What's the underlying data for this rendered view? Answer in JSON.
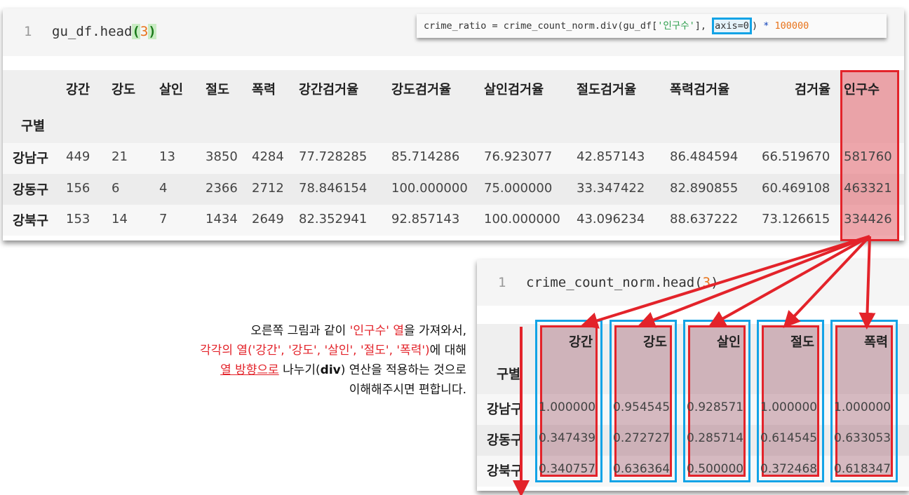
{
  "top_cell": {
    "line_number": "1",
    "code_prefix": "gu_df.head",
    "code_paren_open": "(",
    "code_arg": "3",
    "code_paren_close": ")"
  },
  "tooltip": {
    "part1": "crime_ratio = crime_count_norm.div(gu_df[",
    "string": "'인구수'",
    "part2": "], ",
    "highlight": "axis=0",
    "part3": ") ",
    "mul": "*",
    "number": " 100000"
  },
  "top_table": {
    "index_name": "구별",
    "columns": [
      "강간",
      "강도",
      "살인",
      "절도",
      "폭력",
      "강간검거율",
      "강도검거율",
      "살인검거율",
      "절도검거율",
      "폭력검거율",
      "검거율",
      "인구수"
    ],
    "rows": [
      {
        "index": "강남구",
        "values": [
          "449",
          "21",
          "13",
          "3850",
          "4284",
          "77.728285",
          "85.714286",
          "76.923077",
          "42.857143",
          "86.484594",
          "66.519670",
          "581760"
        ]
      },
      {
        "index": "강동구",
        "values": [
          "156",
          "6",
          "4",
          "2366",
          "2712",
          "78.846154",
          "100.000000",
          "75.000000",
          "33.347422",
          "82.890855",
          "60.469108",
          "463321"
        ]
      },
      {
        "index": "강북구",
        "values": [
          "153",
          "14",
          "7",
          "1434",
          "2649",
          "82.352941",
          "92.857143",
          "100.000000",
          "43.096234",
          "88.637222",
          "73.126615",
          "334426"
        ]
      }
    ]
  },
  "bottom_cell": {
    "line_number": "1",
    "code_prefix": "crime_count_norm.head",
    "code_paren_open": "(",
    "code_arg": "3",
    "code_paren_close": ")"
  },
  "bottom_table": {
    "index_name": "구별",
    "columns": [
      "강간",
      "강도",
      "살인",
      "절도",
      "폭력"
    ],
    "rows": [
      {
        "index": "강남구",
        "values": [
          "1.000000",
          "0.954545",
          "0.928571",
          "1.000000",
          "1.000000"
        ]
      },
      {
        "index": "강동구",
        "values": [
          "0.347439",
          "0.272727",
          "0.285714",
          "0.614545",
          "0.633053"
        ]
      },
      {
        "index": "강북구",
        "values": [
          "0.340757",
          "0.636364",
          "0.500000",
          "0.372468",
          "0.618347"
        ]
      }
    ]
  },
  "annotation": {
    "l1_a": "오른쪽 그림과 같이 ",
    "l1_b": "'인구수' 열",
    "l1_c": "을 가져와서,",
    "l2_a": "각각의 열('강간', '강도', '살인', '절도', '폭력')",
    "l2_b": "에 대해",
    "l3_a": "열 방향으로",
    "l3_b": " 나누기(",
    "l3_c": "div",
    "l3_d": ") 연산을 적용하는 것으로",
    "l4": "이해해주시면 편합니다."
  },
  "colors": {
    "highlight_red": "#e3232a",
    "highlight_blue": "#12a3e6"
  }
}
